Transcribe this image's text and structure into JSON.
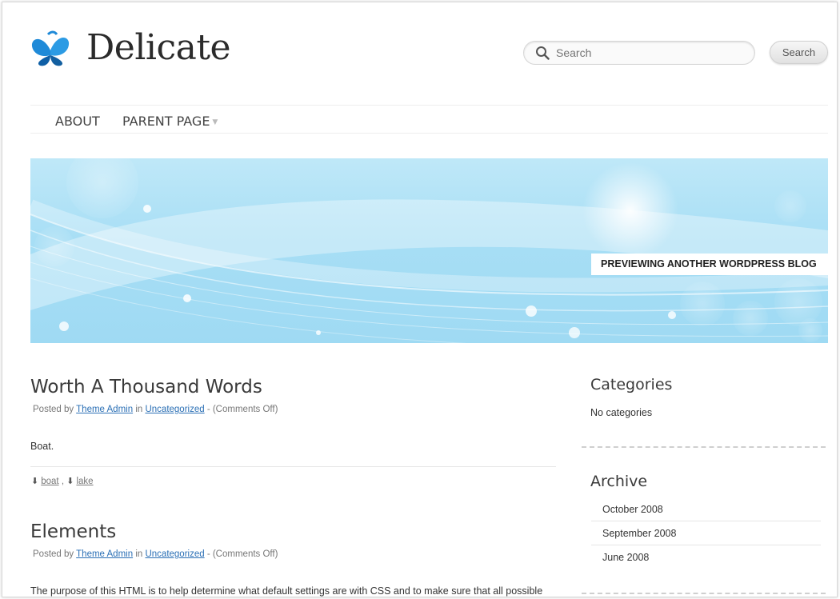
{
  "site": {
    "title": "Delicate"
  },
  "search": {
    "placeholder": "Search",
    "button_label": "Search"
  },
  "nav": {
    "items": [
      {
        "label": "ABOUT"
      },
      {
        "label": "PARENT PAGE"
      }
    ]
  },
  "banner": {
    "caption": "PREVIEWING ANOTHER WORDPRESS BLOG"
  },
  "posts": [
    {
      "title": "Worth A Thousand Words",
      "meta_prefix": "Posted by",
      "author": "Theme Admin",
      "meta_in": "in",
      "category": "Uncategorized",
      "comments": "- (Comments Off)",
      "body": "Boat.",
      "tags": [
        "boat",
        "lake"
      ],
      "tag_sep": ","
    },
    {
      "title": "Elements",
      "meta_prefix": "Posted by",
      "author": "Theme Admin",
      "meta_in": "in",
      "category": "Uncategorized",
      "comments": "- (Comments Off)",
      "body": "The purpose of this HTML is to help determine what default settings are with CSS and to make sure that all possible"
    }
  ],
  "sidebar": {
    "categories": {
      "title": "Categories",
      "empty_text": "No categories"
    },
    "archive": {
      "title": "Archive",
      "items": [
        "October 2008",
        "September 2008",
        "June 2008"
      ]
    }
  },
  "colors": {
    "link": "#2a6fb5",
    "logo_blue": "#1b7fd0",
    "banner_sky": "#a7def5"
  }
}
